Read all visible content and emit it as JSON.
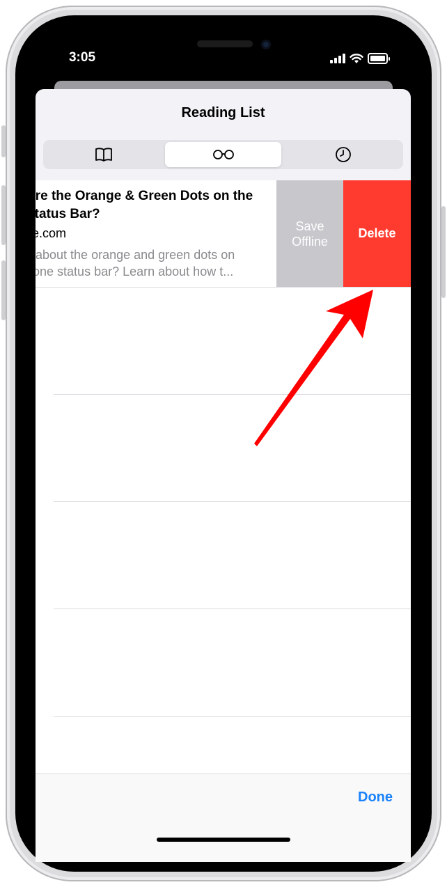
{
  "status_bar": {
    "time": "3:05"
  },
  "sheet": {
    "title": "Reading List"
  },
  "segments": [
    {
      "icon": "book-icon",
      "selected": false
    },
    {
      "icon": "glasses-icon",
      "selected": true
    },
    {
      "icon": "clock-icon",
      "selected": false
    }
  ],
  "reading_item": {
    "title": "Are the Orange & Green Dots on the Status Bar?",
    "source": "ife.com",
    "description": "s about the orange and green dots on hone status bar? Learn about how t..."
  },
  "swipe_actions": {
    "save_offline_line1": "Save",
    "save_offline_line2": "Offline",
    "delete": "Delete"
  },
  "toolbar": {
    "done": "Done"
  },
  "colors": {
    "delete": "#ff3b30",
    "save_offline": "#c7c7cc",
    "accent": "#1a82fb",
    "annotation_arrow": "#ff0000"
  }
}
